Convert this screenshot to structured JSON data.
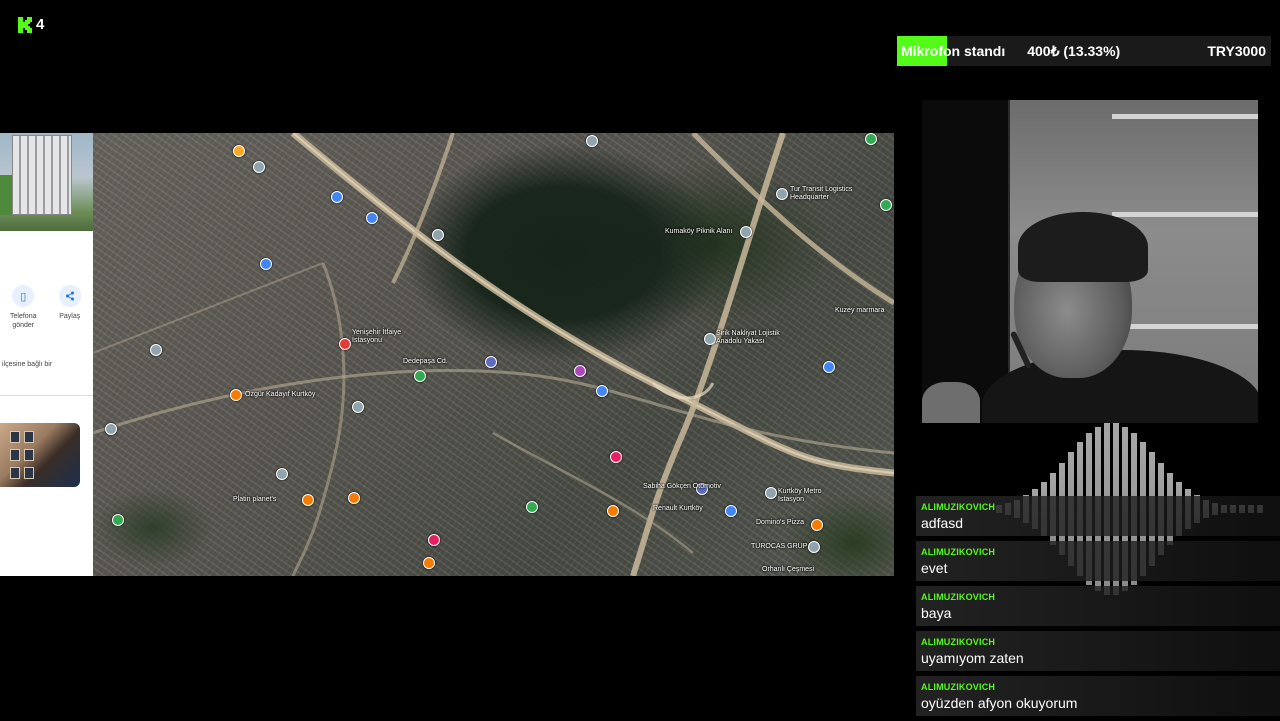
{
  "logo": {
    "letter": "K",
    "number": "4",
    "color": "#53fc18"
  },
  "goal": {
    "item": "Mikrofon standı",
    "raised": "400₺ (13.33%)",
    "target": "TRY3000",
    "progress_fraction": 0.1333,
    "accent": "#53fc18"
  },
  "maps_panel": {
    "actions": [
      {
        "icon": "phone-icon",
        "label": "Telefona gönder"
      },
      {
        "icon": "share-icon",
        "label": "Paylaş"
      }
    ],
    "description": "ilçesine bağlı bir"
  },
  "map": {
    "labels": [
      "Kumaköy Piknik Alanı",
      "Tur Transit Logistics Headquarter",
      "Kuzey marmara",
      "Yenişehir İtfaiye İstasyonu",
      "Dedepaşa Cd.",
      "Platin planet's",
      "Özgür Kadayıf Kurtköy",
      "Sirik Nakliyat Lojistik Anadolu Yakası",
      "Kurtköy Metro İstasyon",
      "Domino's Pizza",
      "TUROCAS GRUP",
      "Orhanlı Çeşmesi",
      "Sabiha Gökçen Otomotiv",
      "Renault Kurtköy"
    ]
  },
  "chat": {
    "username_color": "#53fc18",
    "messages": [
      {
        "user": "ALIMUZIKOVICH",
        "text": "adfasd"
      },
      {
        "user": "ALIMUZIKOVICH",
        "text": "evet"
      },
      {
        "user": "ALIMUZIKOVICH",
        "text": "baya"
      },
      {
        "user": "ALIMUZIKOVICH",
        "text": "uyamıyom zaten"
      },
      {
        "user": "ALIMUZIKOVICH",
        "text": "oyüzden afyon okuyorum"
      }
    ]
  }
}
